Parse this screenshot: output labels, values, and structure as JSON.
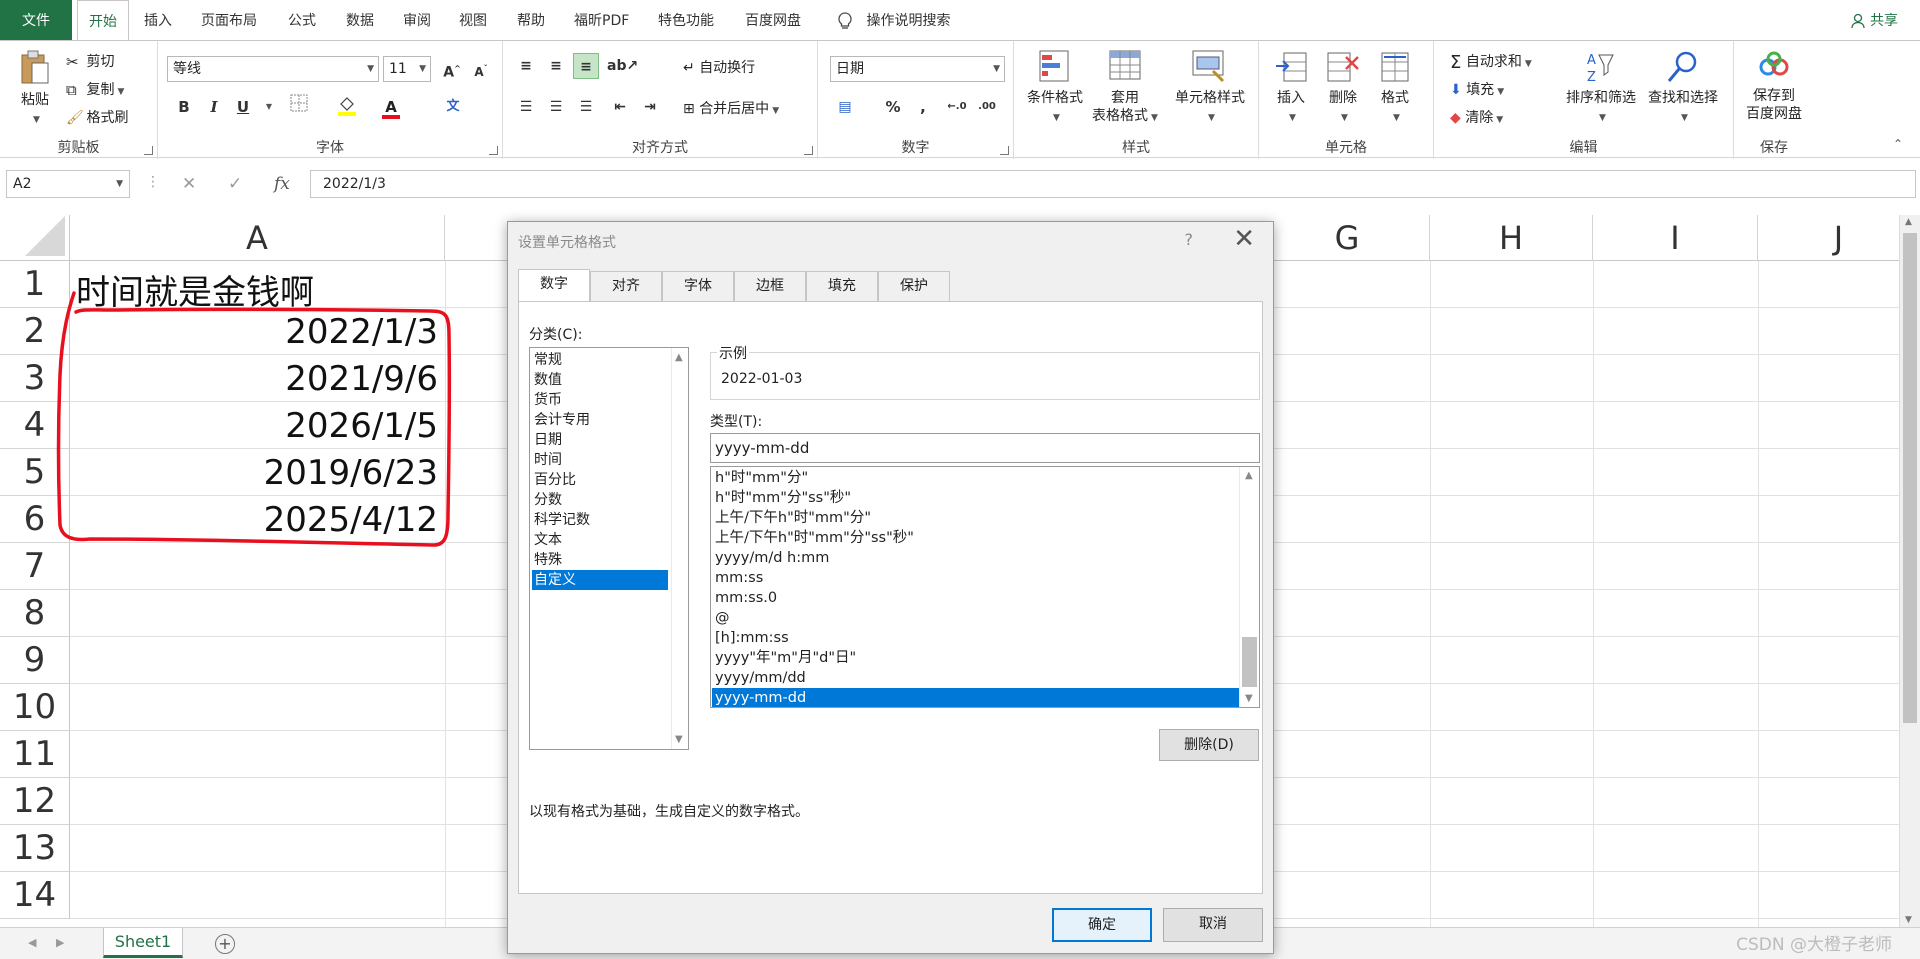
{
  "menu": {
    "tabs": [
      "文件",
      "开始",
      "插入",
      "页面布局",
      "公式",
      "数据",
      "审阅",
      "视图",
      "帮助",
      "福昕PDF",
      "特色功能",
      "百度网盘"
    ],
    "tell_me": "操作说明搜索",
    "share": "共享"
  },
  "ribbon": {
    "clipboard": {
      "paste": "粘贴",
      "cut": "剪切",
      "copy": "复制",
      "format_painter": "格式刷",
      "label": "剪贴板"
    },
    "font": {
      "name": "等线",
      "size": "11",
      "label": "字体",
      "bold": "B",
      "italic": "I",
      "underline": "U"
    },
    "align": {
      "wrap": "自动换行",
      "merge": "合并后居中",
      "label": "对齐方式"
    },
    "number": {
      "format": "日期",
      "percent": "%",
      "comma": ",",
      "label": "数字"
    },
    "styles": {
      "conditional": "条件格式",
      "table_1": "套用",
      "table_2": "表格格式",
      "cell_styles": "单元格样式",
      "label": "样式"
    },
    "cells": {
      "insert": "插入",
      "delete": "删除",
      "format": "格式",
      "label": "单元格"
    },
    "edit": {
      "autosum": "自动求和",
      "fill": "填充",
      "clear": "清除",
      "sort": "排序和筛选",
      "find": "查找和选择",
      "label": "编辑"
    },
    "save": {
      "line1": "保存到",
      "line2": "百度网盘",
      "label": "保存"
    }
  },
  "formula": {
    "name_box": "A2",
    "fx": "fx",
    "value": "2022/1/3"
  },
  "grid": {
    "columns": [
      "A",
      "G",
      "H",
      "I",
      "J"
    ],
    "rows": [
      "1",
      "2",
      "3",
      "4",
      "5",
      "6",
      "7",
      "8",
      "9",
      "10",
      "11",
      "12",
      "13",
      "14"
    ],
    "a1": "时间就是金钱啊",
    "dates": [
      "2022/1/3",
      "2021/9/6",
      "2026/1/5",
      "2019/6/23",
      "2025/4/12"
    ]
  },
  "sheets": {
    "active": "Sheet1",
    "add": "+"
  },
  "watermark": "CSDN @大橙子老师",
  "dialog": {
    "title": "设置单元格格式",
    "help": "?",
    "close": "✕",
    "tabs": [
      "数字",
      "对齐",
      "字体",
      "边框",
      "填充",
      "保护"
    ],
    "category_label": "分类(C):",
    "categories": [
      "常规",
      "数值",
      "货币",
      "会计专用",
      "日期",
      "时间",
      "百分比",
      "分数",
      "科学记数",
      "文本",
      "特殊",
      "自定义"
    ],
    "selected_category": "自定义",
    "sample_label": "示例",
    "sample_value": "2022-01-03",
    "type_label": "类型(T):",
    "type_value": "yyyy-mm-dd",
    "types": [
      "h\"时\"mm\"分\"",
      "h\"时\"mm\"分\"ss\"秒\"",
      "上午/下午h\"时\"mm\"分\"",
      "上午/下午h\"时\"mm\"分\"ss\"秒\"",
      "yyyy/m/d h:mm",
      "mm:ss",
      "mm:ss.0",
      "@",
      "[h]:mm:ss",
      "yyyy\"年\"m\"月\"d\"日\"",
      "yyyy/mm/dd",
      "yyyy-mm-dd"
    ],
    "selected_type": "yyyy-mm-dd",
    "delete_button": "删除(D)",
    "hint": "以现有格式为基础，生成自定义的数字格式。",
    "ok": "确定",
    "cancel": "取消"
  },
  "colors": {
    "excel_green": "#217346",
    "selection_blue": "#0078d7",
    "annotation_red": "#e8101e"
  }
}
